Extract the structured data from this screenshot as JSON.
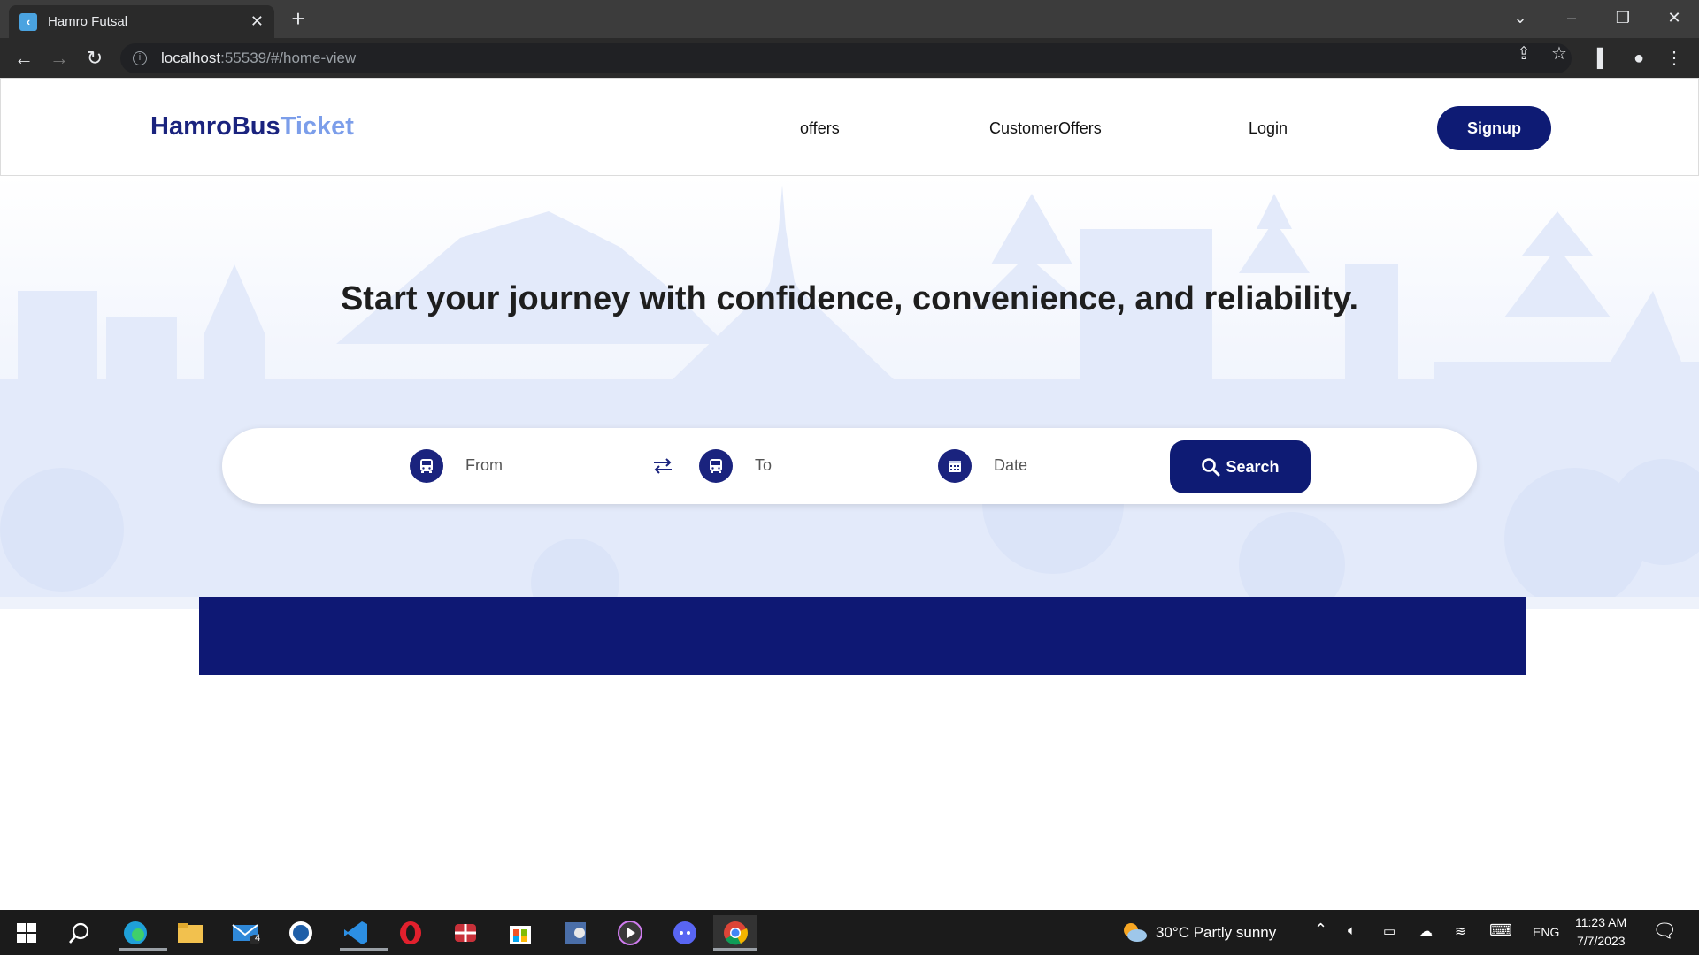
{
  "browser": {
    "tab_title": "Hamro Futsal",
    "url_host": "localhost",
    "url_rest": ":55539/#/home-view"
  },
  "header": {
    "logo_part1": "HamroBus",
    "logo_part2": "Ticket",
    "nav": [
      "offers",
      "CustomerOffers",
      "Login"
    ],
    "signup_label": "Signup"
  },
  "hero": {
    "title": "Start your journey with confidence, convenience, and reliability."
  },
  "search": {
    "from_placeholder": "From",
    "to_placeholder": "To",
    "date_placeholder": "Date",
    "button_label": "Search"
  },
  "taskbar": {
    "mail_badge": "4",
    "weather": "30°C  Partly sunny",
    "language": "ENG",
    "time": "11:23 AM",
    "date": "7/7/2023"
  },
  "colors": {
    "brand_dark": "#0e1b74",
    "brand_light": "#7c9eea"
  }
}
